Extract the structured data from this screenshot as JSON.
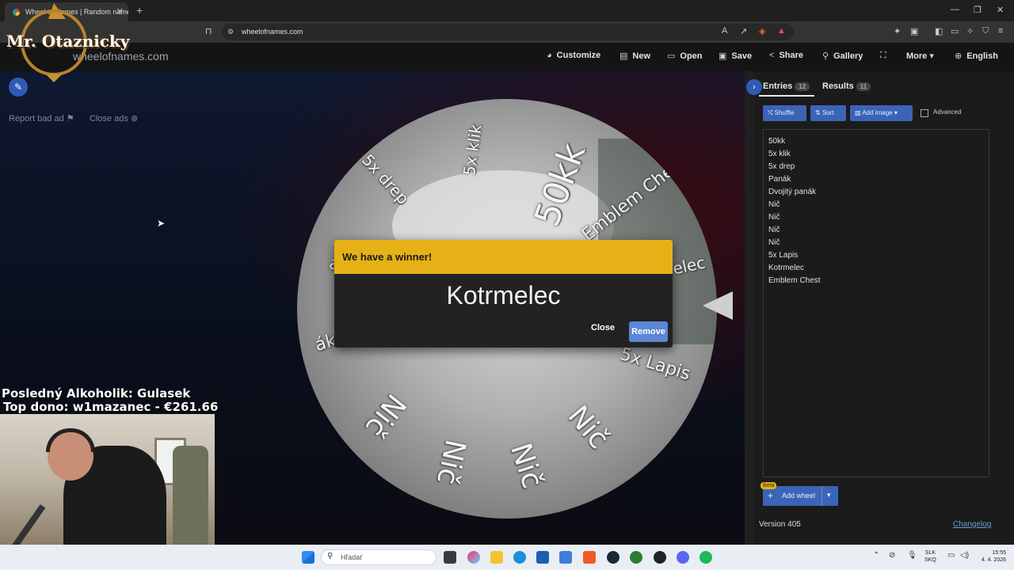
{
  "browser": {
    "tab_title": "Wheel of Names | Random name picker",
    "url": "wheelofnames.com",
    "new_tab": "+",
    "tab_close": "✕",
    "window_controls": [
      "—",
      "❐",
      "✕"
    ]
  },
  "site": {
    "logo_text": "wheelofnames.com",
    "nav": [
      {
        "icon": "palette-icon",
        "glyph": "◕",
        "label": "Customize"
      },
      {
        "icon": "file-icon",
        "glyph": "▤",
        "label": "New"
      },
      {
        "icon": "folder-icon",
        "glyph": "▭",
        "label": "Open"
      },
      {
        "icon": "save-icon",
        "glyph": "▣",
        "label": "Save"
      },
      {
        "icon": "share-icon",
        "glyph": "<",
        "label": "Share"
      },
      {
        "icon": "search-icon",
        "glyph": "⚲",
        "label": "Gallery"
      },
      {
        "icon": "fullscreen-icon",
        "glyph": "⛶",
        "label": ""
      },
      {
        "icon": "chevron-down-icon",
        "glyph": "▾",
        "label": "More"
      },
      {
        "icon": "globe-icon",
        "glyph": "⊕",
        "label": "English"
      }
    ],
    "report_bad_ad": "Report bad ad",
    "close_ads": "Close ads"
  },
  "wheel": {
    "segments": [
      "50kk",
      "5x klik",
      "5x drep",
      "Panák",
      "Dvojitý panák",
      "Nič",
      "Nič",
      "Nič",
      "Nič",
      "5x Lapis",
      "Kotrmelec",
      "Emblem Chest"
    ],
    "visible_text": {
      "t50kk": "50kk",
      "tklik": "5x klik",
      "tdrep": "5x drep",
      "tchest": "Emblem Chest",
      "tmelec": "elec",
      "tlapis": "5x Lapis",
      "tnic1": "Nič",
      "tnic2": "Nič",
      "tnic3": "Nič",
      "tnic4": "Nič",
      "tpanak1": "ák",
      "tpanak2": "ák"
    }
  },
  "dialog": {
    "header": "We have a winner!",
    "winner": "Kotrmelec",
    "close": "Close",
    "remove": "Remove"
  },
  "panel": {
    "entries_label": "Entries",
    "entries_count": "12",
    "results_label": "Results",
    "results_count": "11",
    "shuffle": "Shuffle",
    "sort": "Sort",
    "add_image": "Add image",
    "advanced": "Advanced",
    "entries": [
      "50kk",
      "5x klik",
      "5x drep",
      "Panák",
      "Dvojitý panák",
      "Nič",
      "Nič",
      "Nič",
      "Nič",
      "5x Lapis",
      "Kotrmelec",
      "Emblem Chest"
    ],
    "beta": "Beta",
    "add_wheel": "Add wheel",
    "version": "Version 405",
    "changelog": "Changelog"
  },
  "stream": {
    "streamer_name": "Mr. Otaznicky",
    "line1": "Posledný Alkoholik: Gulasek",
    "line2": "Top dono: w1mazanec - €261.66"
  },
  "taskbar": {
    "search_placeholder": "Hľadať",
    "lang_top": "SLK",
    "lang_bottom": "SKQ",
    "time": "15:55",
    "date": "4. 4. 2026"
  },
  "colors": {
    "accent_blue": "#3b64b7",
    "winner_yellow": "#e6b117",
    "remove_blue": "#5b86d6"
  }
}
